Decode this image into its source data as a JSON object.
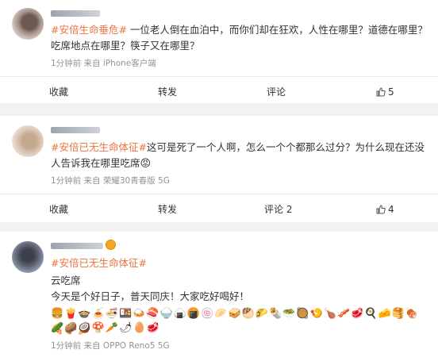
{
  "posts": [
    {
      "topic": "#安倍生命垂危#",
      "body": " 一位老人倒在血泊中，而你们却在狂欢，人性在哪里？道德在哪里？吃席地点在哪里？筷子又在哪里？",
      "meta": "1分钟前  来自 iPhone客户端",
      "actions": {
        "collect": "收藏",
        "repost": "转发",
        "comment": "评论",
        "like_count": "5"
      }
    },
    {
      "topic": "#安倍已无生命体征#",
      "body": "这可是死了一个人啊，怎么一个个都那么过分？为什么现在还没人告诉我在哪里吃席",
      "emoji_end": "😡",
      "meta": "1分钟前  来自 荣耀30青春版 5G",
      "actions": {
        "collect": "收藏",
        "repost": "转发",
        "comment": "评论 2",
        "like_count": "4"
      }
    },
    {
      "topic": "#安倍已无生命体征#",
      "line2": "云吃席",
      "line3": "今天是个好日子，普天同庆！大家吃好喝好！",
      "emojis_row1": [
        "🍔",
        "🍟",
        "🍲",
        "🍝",
        "🍜",
        "🍱",
        "🍛",
        "🍣",
        "🍚",
        "🍙",
        "🍘",
        "🍥",
        "🥟",
        "🥪",
        "🥙",
        "🌮",
        "🌯",
        "🥗",
        "🥘",
        "🍤",
        "🍗",
        "🥓",
        "🥩",
        "🍳",
        "🧀",
        "🥞",
        "🍖",
        "🍕",
        "🥐",
        "🥖",
        "🥨",
        "🥦",
        "🥬",
        "🥒"
      ],
      "emojis_row2": [
        "🥒",
        "🥔",
        "🥥",
        "🍄",
        "🥕",
        "🌶",
        "🥚",
        "🥩"
      ],
      "meta": "1分钟前  来自 OPPO Reno5 5G"
    }
  ]
}
